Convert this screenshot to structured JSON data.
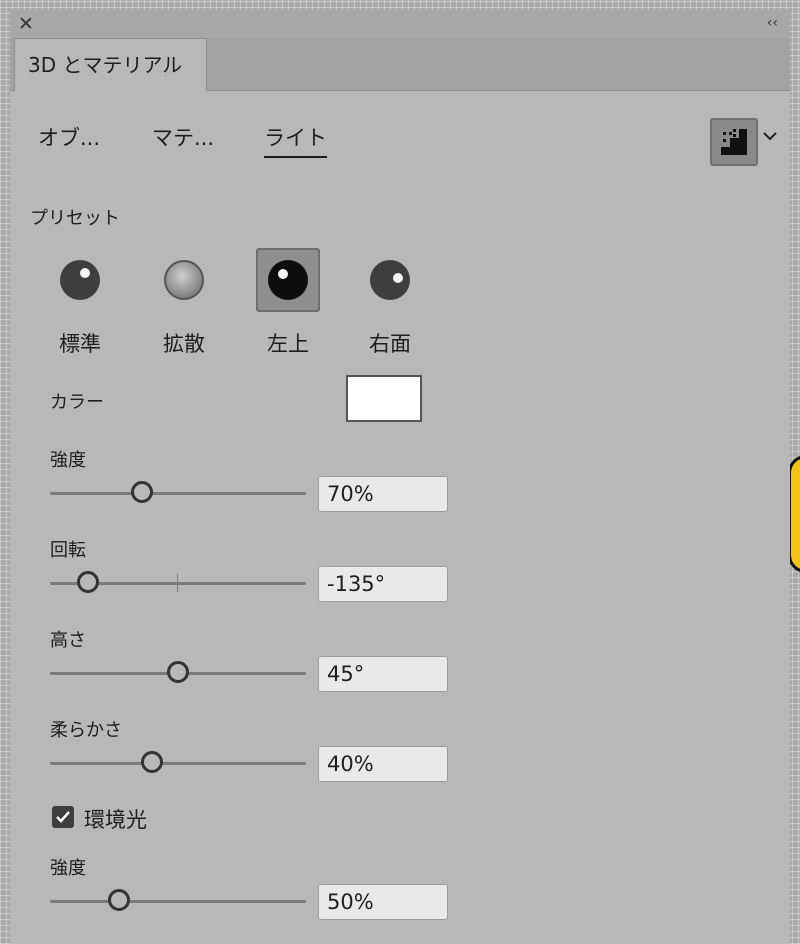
{
  "panel": {
    "tab_title": "3D とマテリアル",
    "close_glyph": "✕",
    "collapse_glyph": "‹‹"
  },
  "subtabs": [
    {
      "label": "オブ...",
      "active": false
    },
    {
      "label": "マテ...",
      "active": false
    },
    {
      "label": "ライト",
      "active": true
    }
  ],
  "render_button_icon": "render-quality-icon",
  "presets": {
    "heading": "プリセット",
    "items": [
      {
        "label": "標準",
        "icon": "light-preset-standard-icon",
        "selected": false
      },
      {
        "label": "拡散",
        "icon": "light-preset-diffuse-icon",
        "selected": false
      },
      {
        "label": "左上",
        "icon": "light-preset-top-left-icon",
        "selected": true
      },
      {
        "label": "右面",
        "icon": "light-preset-right-icon",
        "selected": false
      }
    ]
  },
  "color": {
    "label": "カラー",
    "value": "#ffffff"
  },
  "sliders": [
    {
      "id": "intensity",
      "label": "強度",
      "value": "70%",
      "fraction": 0.36,
      "center_tick": false
    },
    {
      "id": "rotation",
      "label": "回転",
      "value": "-135°",
      "fraction": 0.15,
      "center_tick": true
    },
    {
      "id": "height",
      "label": "高さ",
      "value": "45°",
      "fraction": 0.5,
      "center_tick": false
    },
    {
      "id": "softness",
      "label": "柔らかさ",
      "value": "40%",
      "fraction": 0.4,
      "center_tick": false
    }
  ],
  "ambient": {
    "label": "環境光",
    "checked": true,
    "intensity_label": "強度",
    "intensity_value": "50%",
    "intensity_fraction": 0.27
  }
}
